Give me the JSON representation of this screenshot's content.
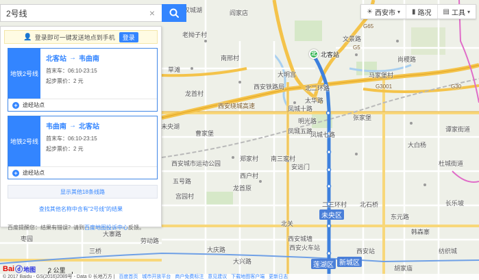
{
  "search": {
    "value": "2号线",
    "clear_label": "×"
  },
  "tools": {
    "city": "西安市",
    "city_icon": "weather-icon",
    "traffic": "路况",
    "toolbox": "工具"
  },
  "panel": {
    "login_text": "登录即可一键发送地点到手机",
    "login_button": "登录",
    "routes": [
      {
        "badge": "地铁2号线",
        "from": "北客站",
        "arrow": "→",
        "to": "韦曲南",
        "first_last": "首末车：06:10-23:15",
        "fare": "起步票价：2 元",
        "stops_label": "途经站点"
      },
      {
        "badge": "地铁2号线",
        "from": "韦曲南",
        "arrow": "→",
        "to": "北客站",
        "first_last": "首末车：06:10-23:15",
        "fare": "起步票价：2 元",
        "stops_label": "途经站点"
      }
    ],
    "more_lines": "显示其他18条线路",
    "search_other": "查找其他名称中含有\"2号线\"的结果",
    "tip_prefix": "百度提醒您：结果有错误？请到",
    "tip_link": "百度地图投诉中心",
    "tip_suffix": "反馈。"
  },
  "map": {
    "station_pin": {
      "badge": "北",
      "label": "北客站"
    },
    "place_labels": [
      "汉城湖",
      "阎家店",
      "老拗子村",
      "南邢村",
      "草滩",
      "龙首村",
      "大明宫",
      "太华路",
      "凤城七路",
      "凤城十路",
      "明光路",
      "文景路",
      "北二环路",
      "西安铁路局",
      "未央湖",
      "曹家堡",
      "马家堡村",
      "尚稷路",
      "文景路",
      "大白杨",
      "谭家街道",
      "杜城街道",
      "郑家村",
      "西户村",
      "南三家村",
      "西安火车站",
      "张家堡",
      "北石桥",
      "五号路",
      "北客站",
      "风景东路",
      "上林路",
      "朝阳小区",
      "宫园村",
      "西安城市运动公园",
      "凤城五路",
      "龙首原",
      "安远门",
      "二三环村",
      "北关",
      "未央区",
      "新城区",
      "莲湖区",
      "西安城墙",
      "大兴路",
      "北稍门",
      "大庆路",
      "雁塔区",
      "西安站",
      "西安市政府",
      "行政中心",
      "胡家庙",
      "东元路",
      "韩森寨",
      "长乐坡",
      "西安工业园",
      "纺织城",
      "三桥",
      "枣园",
      "大寨路",
      "劳动路",
      "西安西站",
      "高新区"
    ],
    "roads": [
      "西安绕城高速",
      "G3001",
      "G5",
      "G65",
      "G30",
      "二环北路",
      "北二环",
      "东二环",
      "西二环",
      "太华北路"
    ]
  },
  "footer": {
    "logo_bai": "Bai",
    "logo_paw": "ⓓ",
    "logo_ditu": "地图",
    "scale": "2 公里",
    "copyright": "© 2017 Baidu - GS(2016)2089号 - Data © 长地万方 |",
    "links": [
      "百度首页",
      "城市开放平台",
      "商户免费标注",
      "意见建议",
      "下载地图客户端",
      "更新日志"
    ]
  },
  "colors": {
    "accent": "#3385ff",
    "metro_line": "#3d80dd",
    "highway": "#f4c34a",
    "pin": "#2bb24c"
  }
}
